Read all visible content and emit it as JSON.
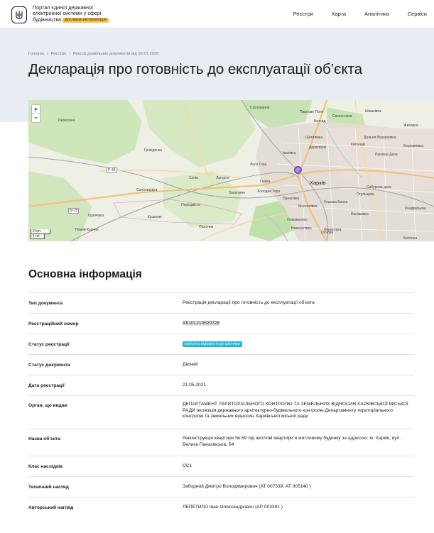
{
  "header": {
    "brand_line1": "Портал єдиної державної",
    "brand_line2": "електронної системи у сфері",
    "brand_line3": "будівництва",
    "brand_badge": "Дослідна експлуатація",
    "nav": [
      "Реєстри",
      "Карта",
      "Аналітика",
      "Сервіси"
    ]
  },
  "breadcrumb": [
    "Головна",
    "Реєстри",
    "Реєстр дозвільних документів від 06.07.2020"
  ],
  "page_title": "Декларація про готовність до експлуатації об’єкта",
  "map": {
    "zoom_in": "+",
    "zoom_out": "−",
    "scale_km": "2 km",
    "scale_mi": "1 mi",
    "labels": [
      "Пересічне",
      "Сортування",
      "Павлове Поле",
      "Сокольники",
      "Шишківка",
      "Ботсад",
      "Жихарка",
      "Шатилівка",
      "Дальня Журавлівка",
      "Гражданка",
      "Іванівка",
      "Держпром",
      "Квітучий",
      "Рашкіна Дача",
      "Березинівка",
      "Солоницівка",
      "Сонів",
      "Лагерне",
      "Лиса Гора",
      "Харків",
      "Холодна Гора",
      "Гієвка",
      "Залютине",
      "Сабурова дача",
      "Панасівка",
      "Москалівка",
      "Основа",
      "Новожаново",
      "Кошова Балка",
      "Балашівка",
      "Огульцова",
      "Новоселівка",
      "Вереєтика",
      "Піскочни",
      "Новий Корчин",
      "Передмістя",
      "Кушкове",
      "Курячівка",
      "Кондратьєва",
      "Бетонна"
    ],
    "city_label": "Харків",
    "road_m": "М-25",
    "road_p": "Р-46"
  },
  "info": {
    "section_title": "Основна інформація",
    "rows": [
      {
        "label": "Тип документа",
        "value": "Реєстрація декларації про готовність до експлуатації об’єкта"
      },
      {
        "label": "Реєстраційний номер",
        "value": "ХК101210520728"
      },
      {
        "label": "Статус реєстрації",
        "value": "внесено відомості до системи"
      },
      {
        "label": "Статус документа",
        "value": "Діючий"
      },
      {
        "label": "Дата реєстрації",
        "value": "21.05.2021"
      },
      {
        "label": "Орган, що видав",
        "value": "ДЕПАРТАМЕНТ ТЕРИТОРІАЛЬНОГО КОНТРОЛЮ ТА ЗЕМЕЛЬНИХ ВІДНОСИН ХАРКІВСЬКОЇ МІСЬКОЇ РАДИ Інспекція державного архітектурно-будівельного контролю Департаменту територіального контролю та земельних відносин Харківської міської ради"
      },
      {
        "label": "Назва об’єкта",
        "value": "Реконструкція квартири № 69 під житлові квартири в житловому будинку за адресою: м. Харків, вул. Велика Панасівська, 54"
      },
      {
        "label": "Клас наслідків",
        "value": "СС1"
      },
      {
        "label": "Технічний нагляд",
        "value": "Заборний Дмитро Володимирович (АТ 007339, АТ 005140 )"
      },
      {
        "label": "Авторський нагляд",
        "value": "ЛЕПЕТИЛО Іван Олександрович (АР 003391 )"
      }
    ]
  },
  "colors": {
    "accent_badge": "#f6c144",
    "status_badge": "#21b8d9",
    "hero_bg": "#e7edf3"
  }
}
